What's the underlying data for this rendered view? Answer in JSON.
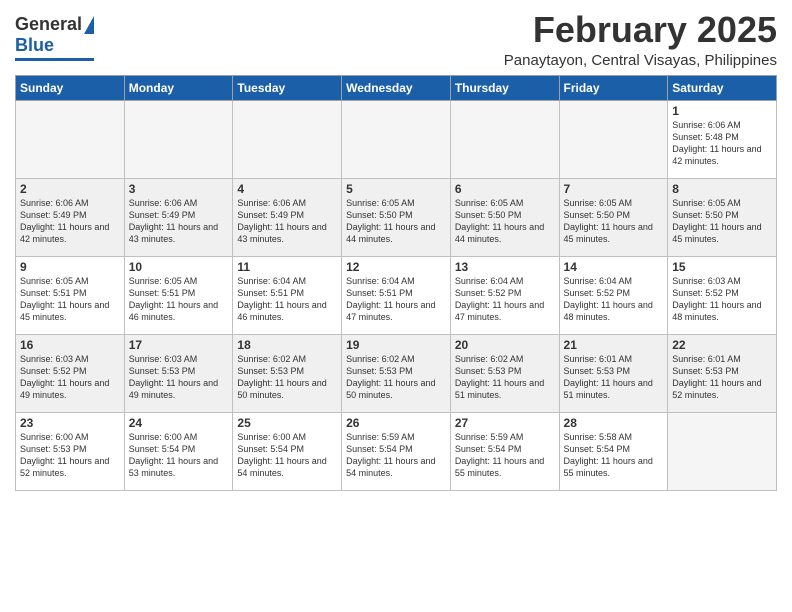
{
  "header": {
    "logo": {
      "general": "General",
      "blue": "Blue"
    },
    "month": "February 2025",
    "location": "Panaytayon, Central Visayas, Philippines"
  },
  "weekdays": [
    "Sunday",
    "Monday",
    "Tuesday",
    "Wednesday",
    "Thursday",
    "Friday",
    "Saturday"
  ],
  "weeks": [
    [
      {
        "day": "",
        "sunrise": "",
        "sunset": "",
        "daylight": "",
        "empty": true
      },
      {
        "day": "",
        "sunrise": "",
        "sunset": "",
        "daylight": "",
        "empty": true
      },
      {
        "day": "",
        "sunrise": "",
        "sunset": "",
        "daylight": "",
        "empty": true
      },
      {
        "day": "",
        "sunrise": "",
        "sunset": "",
        "daylight": "",
        "empty": true
      },
      {
        "day": "",
        "sunrise": "",
        "sunset": "",
        "daylight": "",
        "empty": true
      },
      {
        "day": "",
        "sunrise": "",
        "sunset": "",
        "daylight": "",
        "empty": true
      },
      {
        "day": "1",
        "sunrise": "Sunrise: 6:06 AM",
        "sunset": "Sunset: 5:48 PM",
        "daylight": "Daylight: 11 hours and 42 minutes.",
        "empty": false
      }
    ],
    [
      {
        "day": "2",
        "sunrise": "Sunrise: 6:06 AM",
        "sunset": "Sunset: 5:49 PM",
        "daylight": "Daylight: 11 hours and 42 minutes.",
        "empty": false
      },
      {
        "day": "3",
        "sunrise": "Sunrise: 6:06 AM",
        "sunset": "Sunset: 5:49 PM",
        "daylight": "Daylight: 11 hours and 43 minutes.",
        "empty": false
      },
      {
        "day": "4",
        "sunrise": "Sunrise: 6:06 AM",
        "sunset": "Sunset: 5:49 PM",
        "daylight": "Daylight: 11 hours and 43 minutes.",
        "empty": false
      },
      {
        "day": "5",
        "sunrise": "Sunrise: 6:05 AM",
        "sunset": "Sunset: 5:50 PM",
        "daylight": "Daylight: 11 hours and 44 minutes.",
        "empty": false
      },
      {
        "day": "6",
        "sunrise": "Sunrise: 6:05 AM",
        "sunset": "Sunset: 5:50 PM",
        "daylight": "Daylight: 11 hours and 44 minutes.",
        "empty": false
      },
      {
        "day": "7",
        "sunrise": "Sunrise: 6:05 AM",
        "sunset": "Sunset: 5:50 PM",
        "daylight": "Daylight: 11 hours and 45 minutes.",
        "empty": false
      },
      {
        "day": "8",
        "sunrise": "Sunrise: 6:05 AM",
        "sunset": "Sunset: 5:50 PM",
        "daylight": "Daylight: 11 hours and 45 minutes.",
        "empty": false
      }
    ],
    [
      {
        "day": "9",
        "sunrise": "Sunrise: 6:05 AM",
        "sunset": "Sunset: 5:51 PM",
        "daylight": "Daylight: 11 hours and 45 minutes.",
        "empty": false
      },
      {
        "day": "10",
        "sunrise": "Sunrise: 6:05 AM",
        "sunset": "Sunset: 5:51 PM",
        "daylight": "Daylight: 11 hours and 46 minutes.",
        "empty": false
      },
      {
        "day": "11",
        "sunrise": "Sunrise: 6:04 AM",
        "sunset": "Sunset: 5:51 PM",
        "daylight": "Daylight: 11 hours and 46 minutes.",
        "empty": false
      },
      {
        "day": "12",
        "sunrise": "Sunrise: 6:04 AM",
        "sunset": "Sunset: 5:51 PM",
        "daylight": "Daylight: 11 hours and 47 minutes.",
        "empty": false
      },
      {
        "day": "13",
        "sunrise": "Sunrise: 6:04 AM",
        "sunset": "Sunset: 5:52 PM",
        "daylight": "Daylight: 11 hours and 47 minutes.",
        "empty": false
      },
      {
        "day": "14",
        "sunrise": "Sunrise: 6:04 AM",
        "sunset": "Sunset: 5:52 PM",
        "daylight": "Daylight: 11 hours and 48 minutes.",
        "empty": false
      },
      {
        "day": "15",
        "sunrise": "Sunrise: 6:03 AM",
        "sunset": "Sunset: 5:52 PM",
        "daylight": "Daylight: 11 hours and 48 minutes.",
        "empty": false
      }
    ],
    [
      {
        "day": "16",
        "sunrise": "Sunrise: 6:03 AM",
        "sunset": "Sunset: 5:52 PM",
        "daylight": "Daylight: 11 hours and 49 minutes.",
        "empty": false
      },
      {
        "day": "17",
        "sunrise": "Sunrise: 6:03 AM",
        "sunset": "Sunset: 5:53 PM",
        "daylight": "Daylight: 11 hours and 49 minutes.",
        "empty": false
      },
      {
        "day": "18",
        "sunrise": "Sunrise: 6:02 AM",
        "sunset": "Sunset: 5:53 PM",
        "daylight": "Daylight: 11 hours and 50 minutes.",
        "empty": false
      },
      {
        "day": "19",
        "sunrise": "Sunrise: 6:02 AM",
        "sunset": "Sunset: 5:53 PM",
        "daylight": "Daylight: 11 hours and 50 minutes.",
        "empty": false
      },
      {
        "day": "20",
        "sunrise": "Sunrise: 6:02 AM",
        "sunset": "Sunset: 5:53 PM",
        "daylight": "Daylight: 11 hours and 51 minutes.",
        "empty": false
      },
      {
        "day": "21",
        "sunrise": "Sunrise: 6:01 AM",
        "sunset": "Sunset: 5:53 PM",
        "daylight": "Daylight: 11 hours and 51 minutes.",
        "empty": false
      },
      {
        "day": "22",
        "sunrise": "Sunrise: 6:01 AM",
        "sunset": "Sunset: 5:53 PM",
        "daylight": "Daylight: 11 hours and 52 minutes.",
        "empty": false
      }
    ],
    [
      {
        "day": "23",
        "sunrise": "Sunrise: 6:00 AM",
        "sunset": "Sunset: 5:53 PM",
        "daylight": "Daylight: 11 hours and 52 minutes.",
        "empty": false
      },
      {
        "day": "24",
        "sunrise": "Sunrise: 6:00 AM",
        "sunset": "Sunset: 5:54 PM",
        "daylight": "Daylight: 11 hours and 53 minutes.",
        "empty": false
      },
      {
        "day": "25",
        "sunrise": "Sunrise: 6:00 AM",
        "sunset": "Sunset: 5:54 PM",
        "daylight": "Daylight: 11 hours and 54 minutes.",
        "empty": false
      },
      {
        "day": "26",
        "sunrise": "Sunrise: 5:59 AM",
        "sunset": "Sunset: 5:54 PM",
        "daylight": "Daylight: 11 hours and 54 minutes.",
        "empty": false
      },
      {
        "day": "27",
        "sunrise": "Sunrise: 5:59 AM",
        "sunset": "Sunset: 5:54 PM",
        "daylight": "Daylight: 11 hours and 55 minutes.",
        "empty": false
      },
      {
        "day": "28",
        "sunrise": "Sunrise: 5:58 AM",
        "sunset": "Sunset: 5:54 PM",
        "daylight": "Daylight: 11 hours and 55 minutes.",
        "empty": false
      },
      {
        "day": "",
        "sunrise": "",
        "sunset": "",
        "daylight": "",
        "empty": true
      }
    ]
  ]
}
